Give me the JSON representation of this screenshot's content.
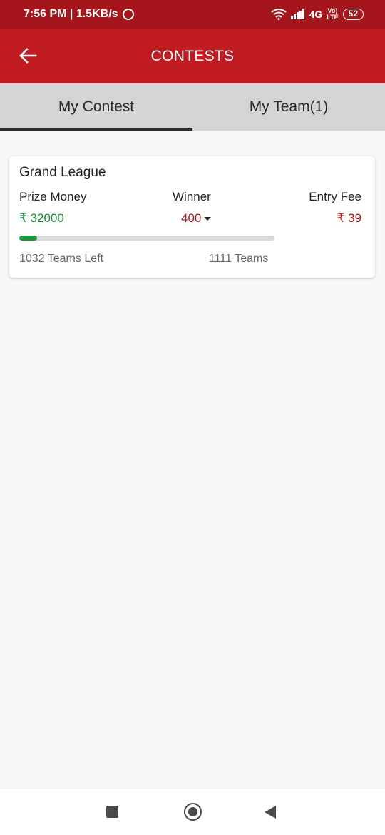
{
  "status_bar": {
    "time_speed": "7:56 PM | 1.5KB/s",
    "network": "4G",
    "volte_top": "Vo)",
    "volte_bottom": "LTE",
    "battery": "52"
  },
  "app_bar": {
    "title": "CONTESTS",
    "back_icon": "arrow-left-icon"
  },
  "tabs": [
    {
      "label": "My Contest",
      "active": true
    },
    {
      "label": "My Team(1)",
      "active": false
    }
  ],
  "contest_card": {
    "title": "Grand League",
    "prize_label": "Prize Money",
    "prize_value": "₹ 32000",
    "winner_label": "Winner",
    "winner_value": "400",
    "fee_label": "Entry Fee",
    "fee_value": "₹ 39",
    "progress_fraction": 0.071,
    "teams_left": "1032 Teams Left",
    "teams_total": "1111 Teams"
  },
  "nav_bar": {
    "recent_icon": "square-icon",
    "home_icon": "circle-icon",
    "back_icon": "triangle-back-icon"
  },
  "colors": {
    "status_bar": "#a4151c",
    "app_bar": "#bf1b21",
    "prize_green": "#1a8f3b",
    "accent_red": "#b01a22",
    "progress_fill": "#1a9a3c"
  }
}
